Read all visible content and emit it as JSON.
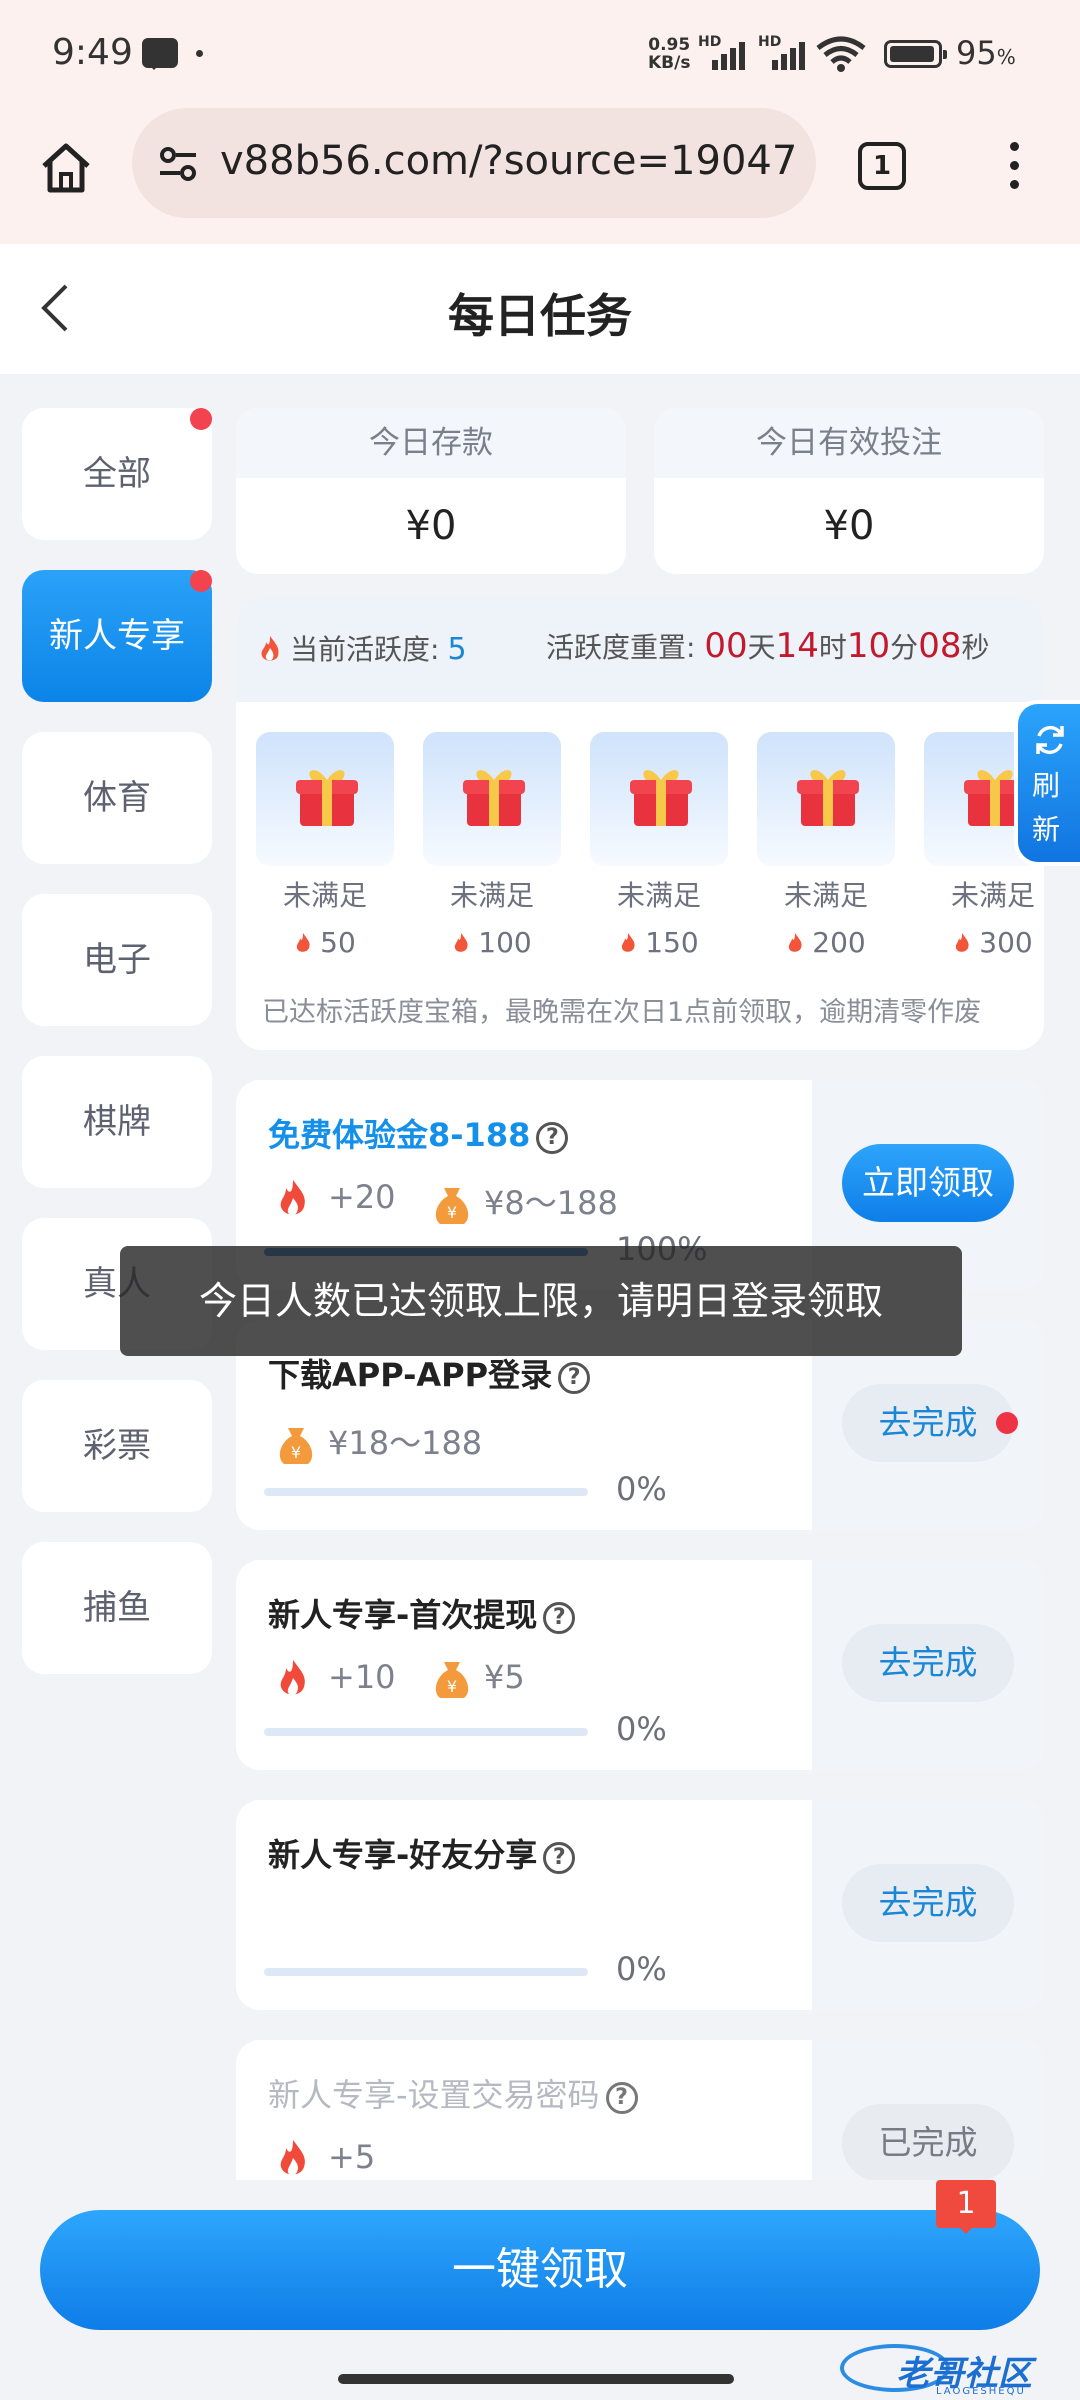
{
  "status_bar": {
    "time": "9:49",
    "net_speed_value": "0.95",
    "net_speed_unit": "KB/s",
    "sim1": "HD",
    "sim2": "HD",
    "battery": "95",
    "battery_unit": "%"
  },
  "browser": {
    "url": "v88b56.com/?source=19047",
    "tab_count": "1"
  },
  "header": {
    "title": "每日任务"
  },
  "sidebar": {
    "items": [
      {
        "label": "全部",
        "dot": true
      },
      {
        "label": "新人专享",
        "dot": true,
        "active": true
      },
      {
        "label": "体育"
      },
      {
        "label": "电子"
      },
      {
        "label": "棋牌"
      },
      {
        "label": "真人"
      },
      {
        "label": "彩票"
      },
      {
        "label": "捕鱼"
      }
    ]
  },
  "summary": {
    "deposit_label": "今日存款",
    "deposit_value": "¥0",
    "bet_label": "今日有效投注",
    "bet_value": "¥0"
  },
  "activity": {
    "current_label": "当前活跃度:",
    "current_value": "5",
    "reset_label": "活跃度重置:",
    "days": "00",
    "days_unit": "天",
    "hours": "14",
    "hours_unit": "时",
    "minutes": "10",
    "minutes_unit": "分",
    "seconds": "08",
    "seconds_unit": "秒",
    "chests": [
      {
        "status": "未满足",
        "points": "50"
      },
      {
        "status": "未满足",
        "points": "100"
      },
      {
        "status": "未满足",
        "points": "150"
      },
      {
        "status": "未满足",
        "points": "200"
      },
      {
        "status": "未满足",
        "points": "300"
      }
    ],
    "note": "已达标活跃度宝箱，最晚需在次日1点前领取，逾期清零作废"
  },
  "refresh": {
    "line1": "刷",
    "line2": "新"
  },
  "tasks": [
    {
      "title": "免费体验金8-188",
      "activity": "+20",
      "money": "¥8～188",
      "progress": "100%",
      "progress_value": 1.0,
      "button": "立即领取"
    },
    {
      "title": "下载APP-APP登录",
      "money": "¥18～188",
      "progress": "0%",
      "progress_value": 0,
      "button": "去完成"
    },
    {
      "title": "新人专享-首次提现",
      "activity": "+10",
      "money": "¥5",
      "progress": "0%",
      "progress_value": 0,
      "button": "去完成"
    },
    {
      "title": "新人专享-好友分享",
      "progress": "0%",
      "progress_value": 0,
      "button": "去完成"
    },
    {
      "title": "新人专享-设置交易密码",
      "activity": "+5",
      "button": "已完成"
    }
  ],
  "toast": "今日人数已达领取上限，请明日登录领取",
  "bottom": {
    "claim_all": "一键领取",
    "badge": "1"
  },
  "watermark": {
    "text": "老哥社区",
    "sub": "LAOGESHEQU"
  },
  "colors": {
    "accent": "#1590ea",
    "danger": "#c3192d",
    "badge": "#f04a3f"
  }
}
